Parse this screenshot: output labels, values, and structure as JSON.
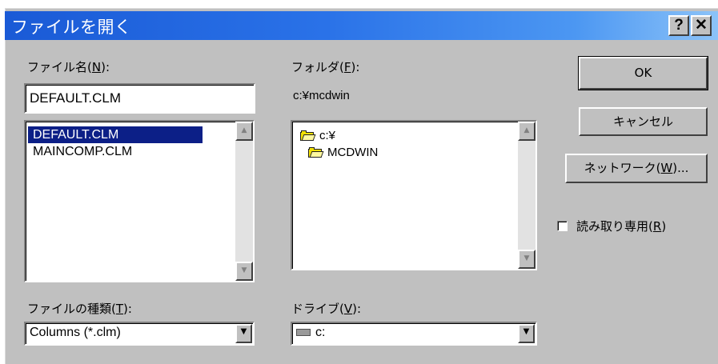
{
  "dialog": {
    "title": "ファイルを開く",
    "help_button": "?",
    "close_button": "✕"
  },
  "filename": {
    "label": "ファイル名",
    "mnemonic": "N",
    "label_paren_open": "(",
    "label_paren_close": "):",
    "value": "DEFAULT.CLM",
    "items": [
      {
        "label": "DEFAULT.CLM",
        "selected": true
      },
      {
        "label": "MAINCOMP.CLM",
        "selected": false
      }
    ]
  },
  "folder": {
    "label": "フォルダ",
    "mnemonic": "F",
    "label_paren_open": "(",
    "label_paren_close": "):",
    "current_path": "c:¥mcdwin",
    "items": [
      {
        "label": "c:¥",
        "icon": "open-folder-icon"
      },
      {
        "label": "MCDWIN",
        "icon": "folder-icon"
      }
    ]
  },
  "filetype": {
    "label": "ファイルの種類",
    "mnemonic": "T",
    "label_paren_open": "(",
    "label_paren_close": "):",
    "value": "Columns (*.clm)"
  },
  "drive": {
    "label": "ドライブ",
    "mnemonic": "V",
    "label_paren_open": "(",
    "label_paren_close": "):",
    "value": "c:",
    "icon": "drive-icon"
  },
  "buttons": {
    "ok": "OK",
    "cancel": "キャンセル",
    "network_prefix": "ネットワーク(",
    "network_mnemonic": "W",
    "network_suffix": ")..."
  },
  "readonly": {
    "label": "読み取り専用",
    "mnemonic": "R",
    "label_paren_open": "(",
    "label_paren_close": ")",
    "checked": false
  },
  "colors": {
    "title_start": "#1a5ad6",
    "title_end": "#8cc3f8",
    "face": "#c0c0c0",
    "selection": "#0c1f87"
  }
}
